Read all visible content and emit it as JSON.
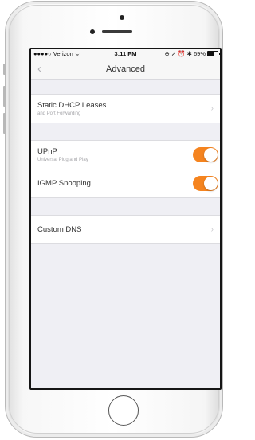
{
  "status_bar": {
    "carrier": "●●●●○ Verizon ᯤ",
    "time": "3:11 PM",
    "icons": "⊕ ➚ ⏰ ✱ 69%"
  },
  "nav": {
    "back_icon": "‹",
    "title": "Advanced"
  },
  "settings": {
    "static_dhcp": {
      "title": "Static DHCP Leases",
      "subtitle": "and Port Forwarding"
    },
    "upnp": {
      "title": "UPnP",
      "subtitle": "Universal Plug and Play",
      "enabled": true
    },
    "igmp": {
      "title": "IGMP Snooping",
      "enabled": true
    },
    "custom_dns": {
      "title": "Custom DNS"
    }
  },
  "colors": {
    "toggle_on": "#f5841f",
    "background": "#efeff4"
  },
  "chevron": "›"
}
